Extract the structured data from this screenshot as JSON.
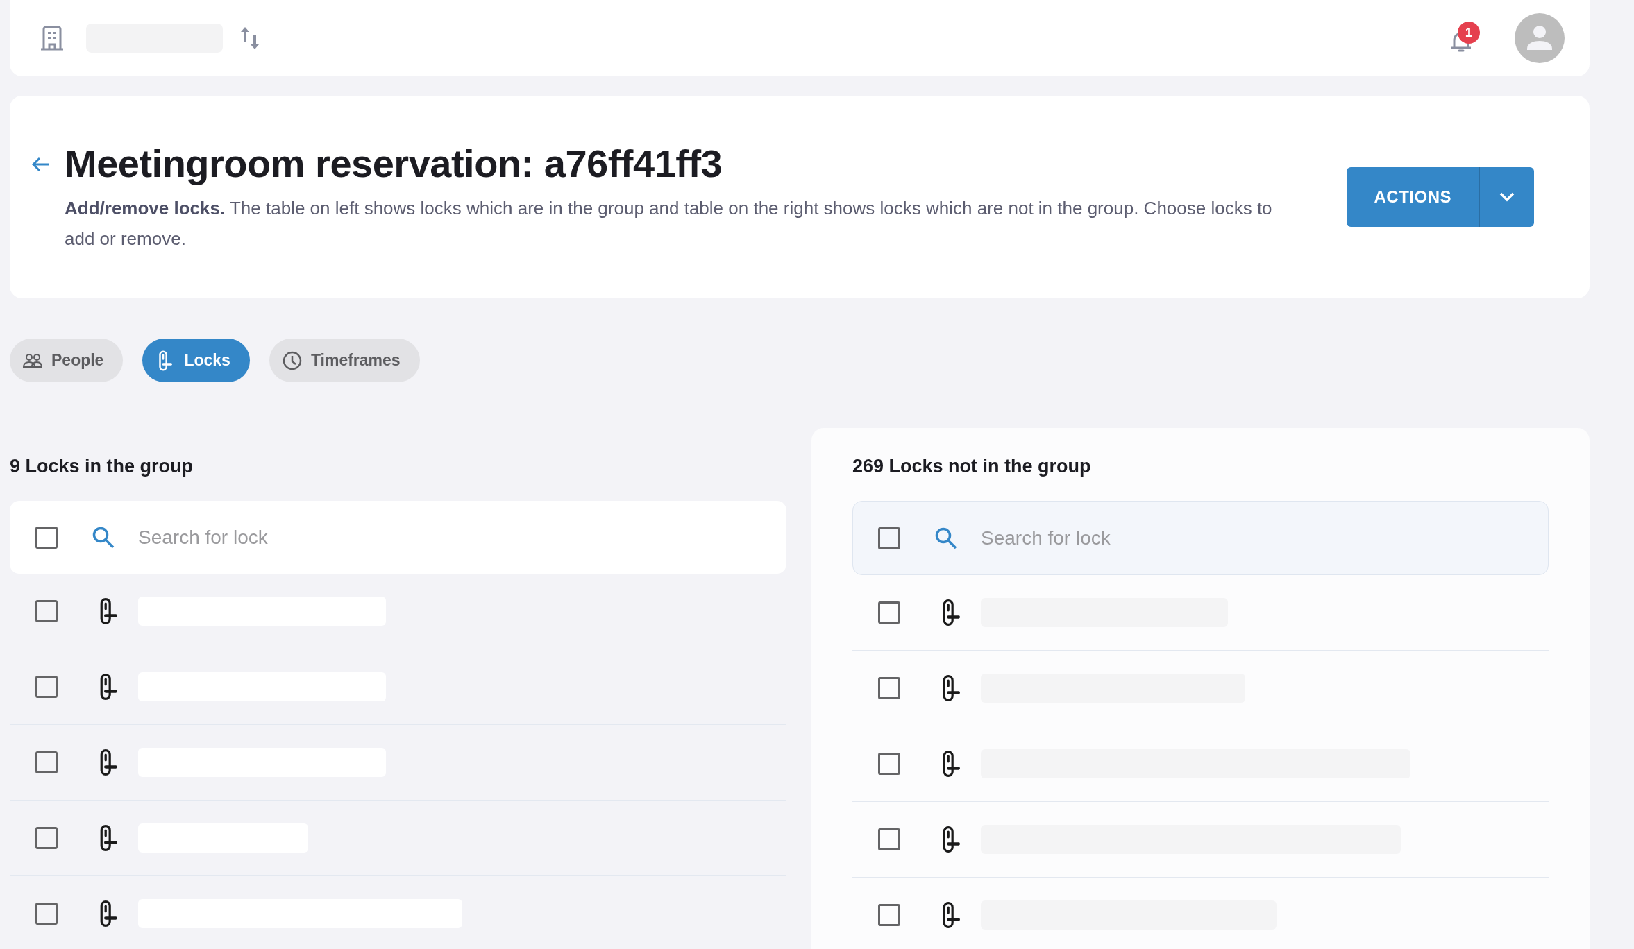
{
  "topbar": {
    "notification_count": "1"
  },
  "header": {
    "title": "Meetingroom reservation: a76ff41ff3",
    "description": "**Add/remove locks.** The table on left shows locks which are in the group and table on the right shows locks which are not in the group. Choose locks to add or remove.",
    "actions_label": "ACTIONS"
  },
  "tabs": [
    {
      "label": "People",
      "kind": "people",
      "selected": false
    },
    {
      "label": "Locks",
      "kind": "lock",
      "selected": true
    },
    {
      "label": "Timeframes",
      "kind": "clock",
      "selected": false
    }
  ],
  "panels": [
    {
      "heading": "9 Locks in the group",
      "search": {
        "placeholder": "Search for lock",
        "checked": false
      },
      "rows": [
        {
          "checked": false
        },
        {
          "checked": false
        },
        {
          "checked": false
        },
        {
          "checked": false
        },
        {
          "checked": false
        }
      ]
    },
    {
      "heading": "269 Locks not in the group",
      "search": {
        "placeholder": "Search for lock",
        "checked": false
      },
      "rows": [
        {
          "checked": false
        },
        {
          "checked": false
        },
        {
          "checked": false
        },
        {
          "checked": false
        },
        {
          "checked": false
        }
      ]
    }
  ]
}
